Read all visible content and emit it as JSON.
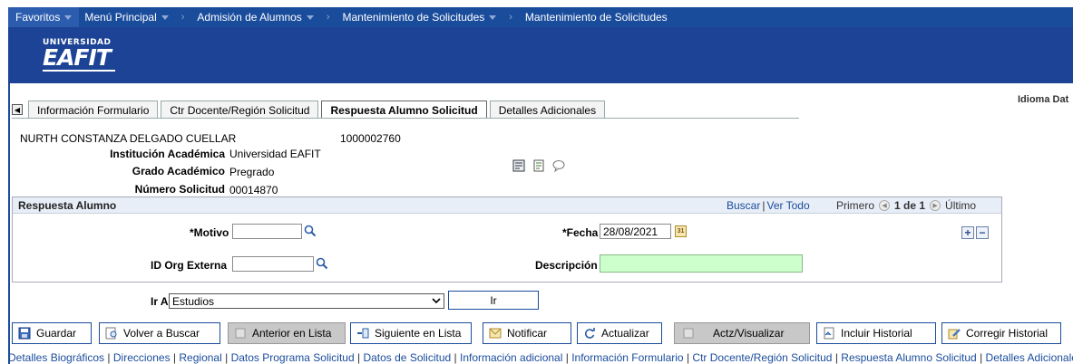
{
  "topnav": {
    "favoritos": "Favoritos",
    "menu_principal": "Menú Principal",
    "breadcrumb": [
      "Admisión de Alumnos",
      "Mantenimiento de Solicitudes",
      "Mantenimiento de Solicitudes"
    ]
  },
  "banner": {
    "logo_top": "UNIVERSIDAD",
    "logo_main": "EAFIT"
  },
  "idioma_label": "Idioma Dat",
  "tabs": [
    {
      "label": "Información Formulario",
      "active": false
    },
    {
      "label": "Ctr Docente/Región Solicitud",
      "active": false
    },
    {
      "label": "Respuesta Alumno Solicitud",
      "active": true
    },
    {
      "label": "Detalles Adicionales",
      "active": false
    }
  ],
  "header": {
    "name": "NURTH CONSTANZA DELGADO CUELLAR",
    "id": "1000002760",
    "institucion_label": "Institución Académica",
    "institucion_value": "Universidad EAFIT",
    "grado_label": "Grado Académico",
    "grado_value": "Pregrado",
    "numero_label": "Número Solicitud",
    "numero_value": "00014870"
  },
  "respuesta": {
    "title": "Respuesta Alumno",
    "buscar": "Buscar",
    "ver_todo": "Ver Todo",
    "primero": "Primero",
    "pagination": "1 de 1",
    "ultimo": "Último",
    "motivo_label": "*Motivo",
    "motivo_value": "",
    "fecha_label": "*Fecha",
    "fecha_value": "28/08/2021",
    "org_label": "ID Org Externa",
    "org_value": "",
    "descripcion_label": "Descripción",
    "descripcion_value": ""
  },
  "ira": {
    "label": "Ir A",
    "selected": "Estudios",
    "button": "Ir"
  },
  "toolbar": {
    "guardar": "Guardar",
    "volver": "Volver a Buscar",
    "anterior": "Anterior en Lista",
    "siguiente": "Siguiente en Lista",
    "notificar": "Notificar",
    "actualizar": "Actualizar",
    "actz": "Actz/Visualizar",
    "incluir": "Incluir Historial",
    "corregir": "Corregir Historial"
  },
  "footer_links": [
    "Detalles Biográficos",
    "Direcciones",
    "Regional",
    "Datos Programa Solicitud",
    "Datos de Solicitud",
    "Información adicional",
    "Información Formulario",
    "Ctr Docente/Región Solicitud",
    "Respuesta Alumno Solicitud",
    "Detalles Adicionales"
  ]
}
